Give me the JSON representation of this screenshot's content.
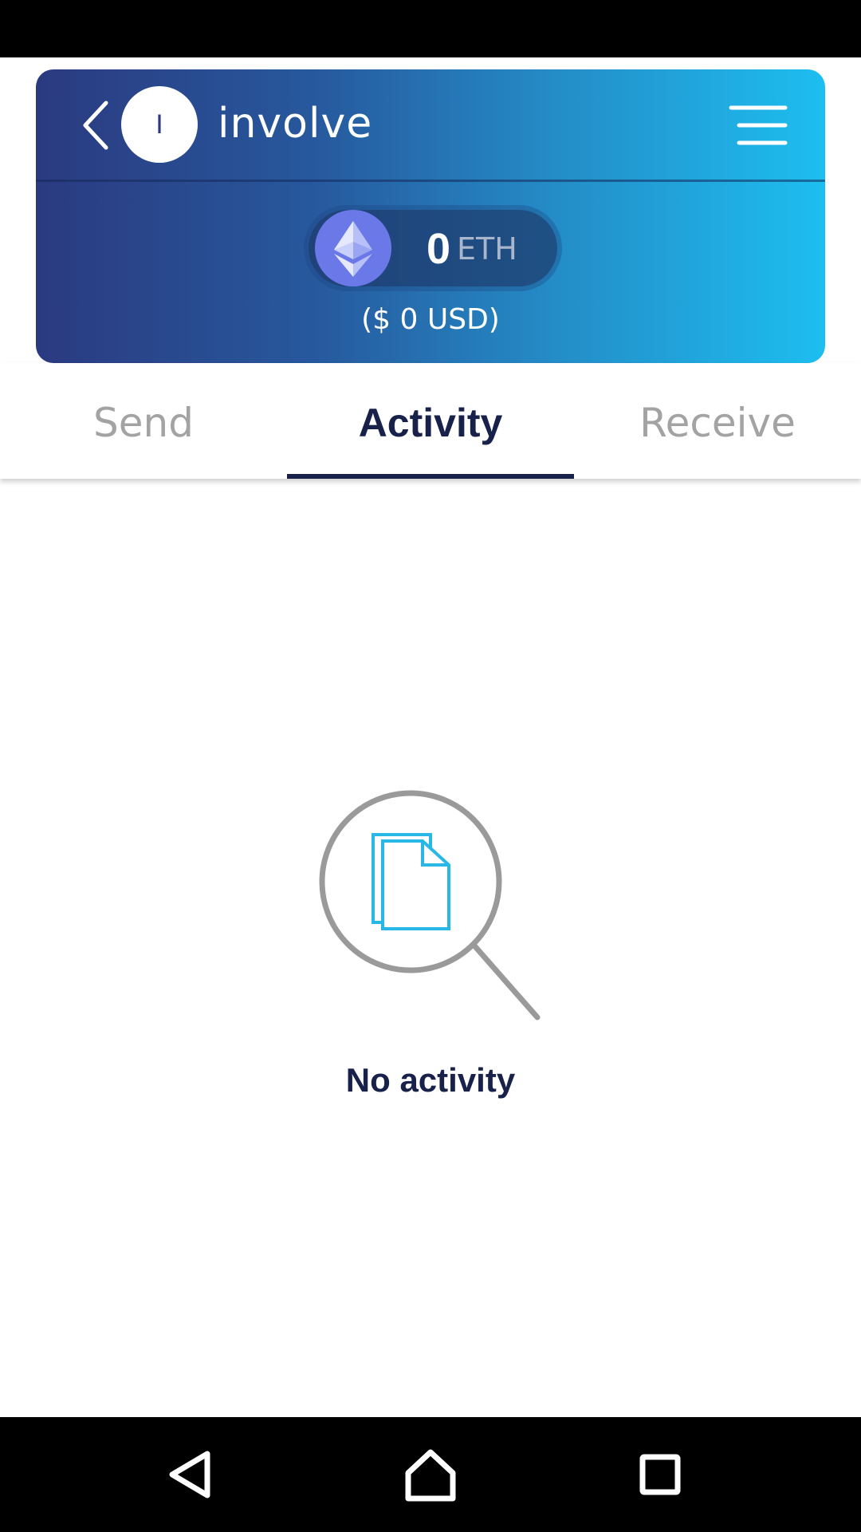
{
  "header": {
    "avatar_letter": "I",
    "wallet_name": "involve",
    "back_icon": "chevron-left-icon",
    "menu_icon": "hamburger-menu-icon"
  },
  "balance": {
    "amount": "0",
    "unit": "ETH",
    "usd": "($ 0 USD)",
    "coin_icon": "ethereum-icon"
  },
  "tabs": [
    {
      "label": "Send",
      "active": false
    },
    {
      "label": "Activity",
      "active": true
    },
    {
      "label": "Receive",
      "active": false
    }
  ],
  "empty_state": {
    "icon": "magnifier-document-icon",
    "text": "No activity"
  },
  "colors": {
    "gradient_start": "#2b3a80",
    "gradient_end": "#1dbef0",
    "active_tab": "#17214a",
    "inactive_tab": "#a3a3a3",
    "eth_badge": "#6a78e8",
    "icon_cyan": "#29b8e6",
    "icon_grey": "#9a9a9a"
  },
  "system_nav": {
    "back_icon": "triangle-back-icon",
    "home_icon": "home-icon",
    "recents_icon": "square-recents-icon"
  }
}
